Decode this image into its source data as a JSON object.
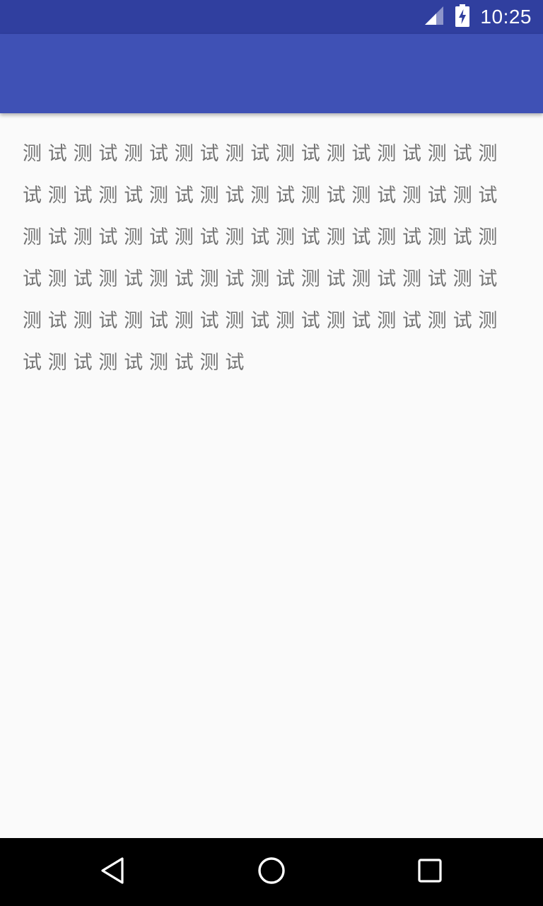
{
  "status_bar": {
    "time": "10:25",
    "background": "#303f9f",
    "icons": [
      "cell-signal-icon",
      "battery-charging-icon"
    ]
  },
  "app_bar": {
    "background": "#3f51b5",
    "title": ""
  },
  "content": {
    "text": "测试测试测试测试测试测试测试测试测试测试测试测试测试测试测试测试测试测试测试测试测试测试测试测试测试测试测试测试测试测试测试测试测试测试测试测试测试测试测试测试测试测试测试测试测试测试测试测试测试测试测试测试",
    "text_color": "#737373",
    "background": "#fafafa"
  },
  "nav_bar": {
    "background": "#000000",
    "buttons": [
      "back-icon",
      "home-icon",
      "recents-icon"
    ]
  }
}
